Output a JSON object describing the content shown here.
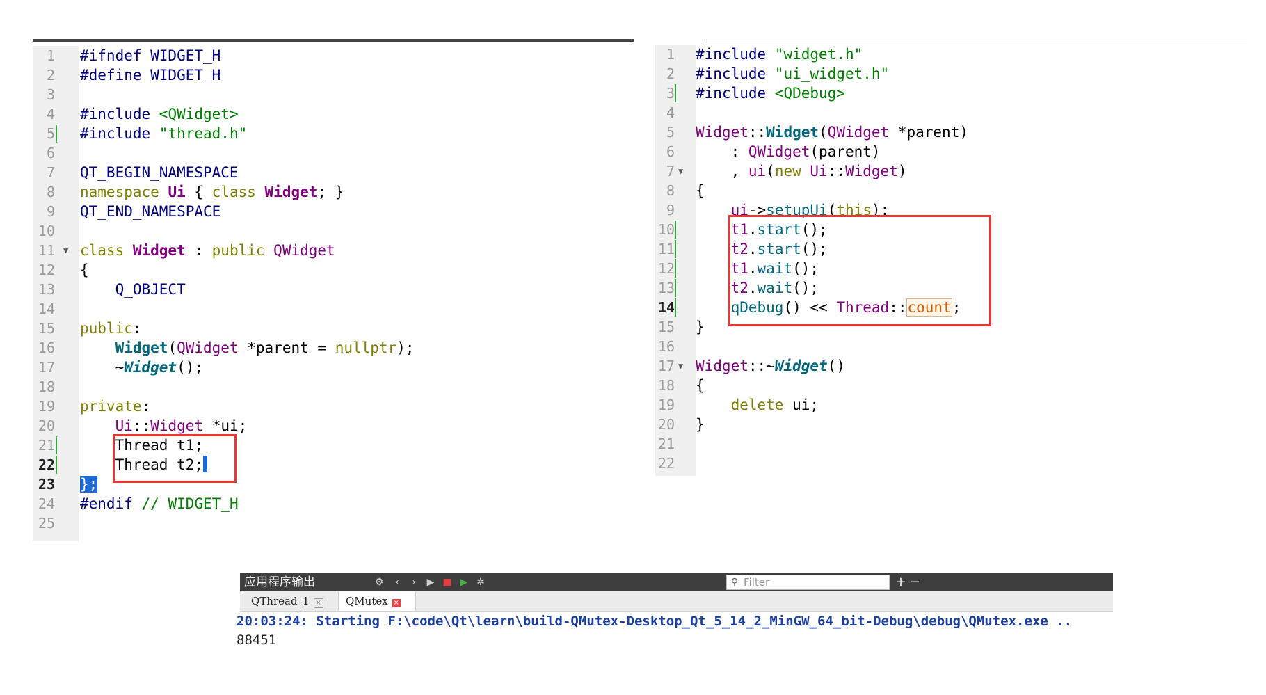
{
  "left_editor": {
    "lines": [
      {
        "n": "1",
        "tokens": [
          {
            "t": "#ifndef WIDGET_H"
          }
        ]
      },
      {
        "n": "2",
        "tokens": [
          {
            "t": "#define WIDGET_H"
          }
        ]
      },
      {
        "n": "3",
        "tokens": []
      },
      {
        "n": "4",
        "tokens": [
          {
            "t": "#include "
          },
          {
            "t": "<QWidget>",
            "c": "t-str"
          }
        ]
      },
      {
        "n": "5",
        "mark": true,
        "tokens": [
          {
            "t": "#include "
          },
          {
            "t": "\"thread.h\"",
            "c": "t-str"
          }
        ]
      },
      {
        "n": "6",
        "tokens": []
      },
      {
        "n": "7",
        "tokens": [
          {
            "t": "QT_BEGIN_NAMESPACE"
          }
        ]
      },
      {
        "n": "8",
        "tokens": [
          {
            "t": "namespace ",
            "c": "t-kw"
          },
          {
            "t": "Ui",
            "c": "t-type t-bold"
          },
          {
            "t": " { ",
            "c": "t-dark"
          },
          {
            "t": "class ",
            "c": "t-kw"
          },
          {
            "t": "Widget",
            "c": "t-type t-bold"
          },
          {
            "t": "; }",
            "c": "t-dark"
          }
        ]
      },
      {
        "n": "9",
        "tokens": [
          {
            "t": "QT_END_NAMESPACE"
          }
        ]
      },
      {
        "n": "10",
        "tokens": []
      },
      {
        "n": "11",
        "fold": true,
        "tokens": [
          {
            "t": "class ",
            "c": "t-kw"
          },
          {
            "t": "Widget",
            "c": "t-type t-bold"
          },
          {
            "t": " : ",
            "c": "t-dark"
          },
          {
            "t": "public ",
            "c": "t-kw"
          },
          {
            "t": "QWidget",
            "c": "t-type"
          }
        ]
      },
      {
        "n": "12",
        "tokens": [
          {
            "t": "{",
            "c": "t-dark"
          }
        ]
      },
      {
        "n": "13",
        "tokens": [
          {
            "t": "    Q_OBJECT"
          }
        ]
      },
      {
        "n": "14",
        "tokens": []
      },
      {
        "n": "15",
        "tokens": [
          {
            "t": "public",
            "c": "t-kw"
          },
          {
            "t": ":",
            "c": "t-dark"
          }
        ]
      },
      {
        "n": "16",
        "tokens": [
          {
            "t": "    "
          },
          {
            "t": "Widget",
            "c": "t-fn t-bold"
          },
          {
            "t": "(",
            "c": "t-dark"
          },
          {
            "t": "QWidget",
            "c": "t-type"
          },
          {
            "t": " *parent = ",
            "c": "t-dark"
          },
          {
            "t": "nullptr",
            "c": "t-kw"
          },
          {
            "t": ");",
            "c": "t-dark"
          }
        ]
      },
      {
        "n": "17",
        "tokens": [
          {
            "t": "    ~",
            "c": "t-dark"
          },
          {
            "t": "Widget",
            "c": "t-fn t-bold t-italic"
          },
          {
            "t": "();",
            "c": "t-dark"
          }
        ]
      },
      {
        "n": "18",
        "tokens": []
      },
      {
        "n": "19",
        "tokens": [
          {
            "t": "private",
            "c": "t-kw"
          },
          {
            "t": ":",
            "c": "t-dark"
          }
        ]
      },
      {
        "n": "20",
        "tokens": [
          {
            "t": "    "
          },
          {
            "t": "Ui",
            "c": "t-type"
          },
          {
            "t": "::",
            "c": "t-dark"
          },
          {
            "t": "Widget",
            "c": "t-type"
          },
          {
            "t": " *ui;",
            "c": "t-dark"
          }
        ]
      },
      {
        "n": "21",
        "mark": true,
        "tokens": [
          {
            "t": "    Thread t1;",
            "c": "t-dark"
          }
        ]
      },
      {
        "n": "22",
        "mark": true,
        "bold": true,
        "cursor": true,
        "tokens": [
          {
            "t": "    Thread t2;",
            "c": "t-dark"
          }
        ]
      },
      {
        "n": "23",
        "bold": true,
        "tokens": [
          {
            "t": "};",
            "c": "sel"
          }
        ]
      },
      {
        "n": "24",
        "tokens": [
          {
            "t": "#endif "
          },
          {
            "t": "// WIDGET_H",
            "c": "t-str"
          }
        ]
      },
      {
        "n": "25",
        "tokens": []
      }
    ]
  },
  "right_editor": {
    "lines": [
      {
        "n": "1",
        "tokens": [
          {
            "t": "#include "
          },
          {
            "t": "\"widget.h\"",
            "c": "t-str"
          }
        ]
      },
      {
        "n": "2",
        "tokens": [
          {
            "t": "#include "
          },
          {
            "t": "\"ui_widget.h\"",
            "c": "t-str"
          }
        ]
      },
      {
        "n": "3",
        "mark": true,
        "tokens": [
          {
            "t": "#include "
          },
          {
            "t": "<QDebug>",
            "c": "t-str"
          }
        ]
      },
      {
        "n": "4",
        "tokens": []
      },
      {
        "n": "5",
        "tokens": [
          {
            "t": "Widget",
            "c": "t-type"
          },
          {
            "t": "::",
            "c": "t-dark"
          },
          {
            "t": "Widget",
            "c": "t-fn t-bold"
          },
          {
            "t": "(",
            "c": "t-dark"
          },
          {
            "t": "QWidget",
            "c": "t-type"
          },
          {
            "t": " *parent)",
            "c": "t-dark"
          }
        ]
      },
      {
        "n": "6",
        "tokens": [
          {
            "t": "    : ",
            "c": "t-dark"
          },
          {
            "t": "QWidget",
            "c": "t-type"
          },
          {
            "t": "(parent)",
            "c": "t-dark"
          }
        ]
      },
      {
        "n": "7",
        "fold": true,
        "tokens": [
          {
            "t": "    , ",
            "c": "t-dark"
          },
          {
            "t": "ui",
            "c": "t-type"
          },
          {
            "t": "(",
            "c": "t-dark"
          },
          {
            "t": "new ",
            "c": "t-kw"
          },
          {
            "t": "Ui",
            "c": "t-type"
          },
          {
            "t": "::",
            "c": "t-dark"
          },
          {
            "t": "Widget",
            "c": "t-type"
          },
          {
            "t": ")",
            "c": "t-dark"
          }
        ]
      },
      {
        "n": "8",
        "tokens": [
          {
            "t": "{",
            "c": "t-dark"
          }
        ]
      },
      {
        "n": "9",
        "tokens": [
          {
            "t": "    "
          },
          {
            "t": "ui",
            "c": "t-type"
          },
          {
            "t": "->",
            "c": "t-dark"
          },
          {
            "t": "setupUi",
            "c": "t-fn"
          },
          {
            "t": "(",
            "c": "t-dark"
          },
          {
            "t": "this",
            "c": "t-kw"
          },
          {
            "t": ");",
            "c": "t-dark"
          }
        ]
      },
      {
        "n": "10",
        "mark": true,
        "tokens": [
          {
            "t": "    "
          },
          {
            "t": "t1",
            "c": "t-type"
          },
          {
            "t": ".",
            "c": "t-dark"
          },
          {
            "t": "start",
            "c": "t-fn"
          },
          {
            "t": "();",
            "c": "t-dark"
          }
        ]
      },
      {
        "n": "11",
        "mark": true,
        "tokens": [
          {
            "t": "    "
          },
          {
            "t": "t2",
            "c": "t-type"
          },
          {
            "t": ".",
            "c": "t-dark"
          },
          {
            "t": "start",
            "c": "t-fn"
          },
          {
            "t": "();",
            "c": "t-dark"
          }
        ]
      },
      {
        "n": "12",
        "mark": true,
        "tokens": [
          {
            "t": "    "
          },
          {
            "t": "t1",
            "c": "t-type"
          },
          {
            "t": ".",
            "c": "t-dark"
          },
          {
            "t": "wait",
            "c": "t-fn"
          },
          {
            "t": "();",
            "c": "t-dark"
          }
        ]
      },
      {
        "n": "13",
        "mark": true,
        "tokens": [
          {
            "t": "    "
          },
          {
            "t": "t2",
            "c": "t-type"
          },
          {
            "t": ".",
            "c": "t-dark"
          },
          {
            "t": "wait",
            "c": "t-fn"
          },
          {
            "t": "();",
            "c": "t-dark"
          }
        ]
      },
      {
        "n": "14",
        "mark": true,
        "bold": true,
        "tokens": [
          {
            "t": "    "
          },
          {
            "t": "qDebug",
            "c": "t-fn"
          },
          {
            "t": "() ",
            "c": "t-dark"
          },
          {
            "t": "<<",
            "c": "t-dark"
          },
          {
            "t": " "
          },
          {
            "t": "Thread",
            "c": "t-type"
          },
          {
            "t": "::",
            "c": "t-dark"
          },
          {
            "t": "count",
            "c": "word-hl"
          },
          {
            "t": ";",
            "c": "t-dark"
          }
        ]
      },
      {
        "n": "15",
        "tokens": [
          {
            "t": "}",
            "c": "t-dark"
          }
        ]
      },
      {
        "n": "16",
        "tokens": []
      },
      {
        "n": "17",
        "fold": true,
        "tokens": [
          {
            "t": "Widget",
            "c": "t-type"
          },
          {
            "t": "::~",
            "c": "t-dark"
          },
          {
            "t": "Widget",
            "c": "t-fn t-bold t-italic"
          },
          {
            "t": "()",
            "c": "t-dark"
          }
        ]
      },
      {
        "n": "18",
        "tokens": [
          {
            "t": "{",
            "c": "t-dark"
          }
        ]
      },
      {
        "n": "19",
        "tokens": [
          {
            "t": "    "
          },
          {
            "t": "delete ",
            "c": "t-kw"
          },
          {
            "t": "ui;",
            "c": "t-dark"
          }
        ]
      },
      {
        "n": "20",
        "tokens": [
          {
            "t": "}",
            "c": "t-dark"
          }
        ]
      },
      {
        "n": "21",
        "tokens": []
      },
      {
        "n": "22",
        "tokens": []
      }
    ]
  },
  "output_panel": {
    "title": "应用程序输出",
    "filter_placeholder": "Filter",
    "tabs": [
      "QThread_1",
      "QMutex"
    ],
    "active_tab": "QMutex",
    "starting_line": "20:03:24: Starting F:\\code\\Qt\\learn\\build-QMutex-Desktop_Qt_5_14_2_MinGW_64_bit-Debug\\debug\\QMutex.exe ..",
    "result_line": "88451",
    "starting_color": "#1a3f9e"
  },
  "colors": {
    "highlight_box": "#e53935",
    "change_marker": "#38a838",
    "keyword": "#808000",
    "type": "#800080",
    "string": "#008000",
    "preprocessor": "#000080"
  }
}
